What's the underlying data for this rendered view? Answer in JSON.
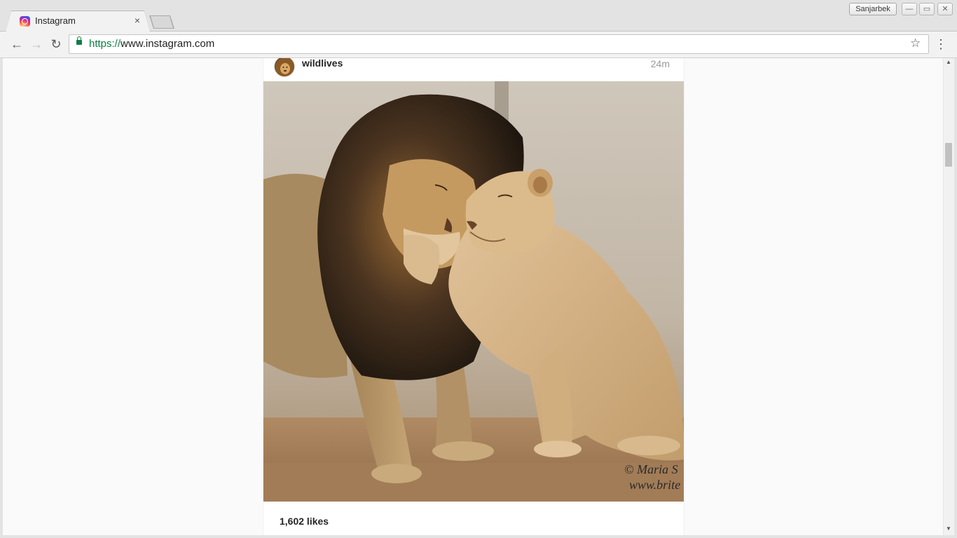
{
  "browser": {
    "tab_title": "Instagram",
    "tab_close": "×",
    "profile_name": "Sanjarbek",
    "url_scheme": "https://",
    "url_rest": "www.instagram.com",
    "window_controls": {
      "minimize": "—",
      "restore": "▭",
      "close": "✕"
    },
    "nav": {
      "back": "←",
      "forward": "→",
      "reload": "↻",
      "star": "☆",
      "menu": "⋮"
    }
  },
  "post": {
    "username": "wildlives",
    "time_ago": "24m",
    "photo_watermark_1": "© Maria S",
    "photo_watermark_2": "www.brite",
    "likes": "1,602 likes"
  },
  "scrollbar": {
    "up": "▲",
    "down": "▼"
  },
  "colors": {
    "secure_green": "#0b8043",
    "page_bg": "#fafafa",
    "post_bg": "#ffffff"
  }
}
